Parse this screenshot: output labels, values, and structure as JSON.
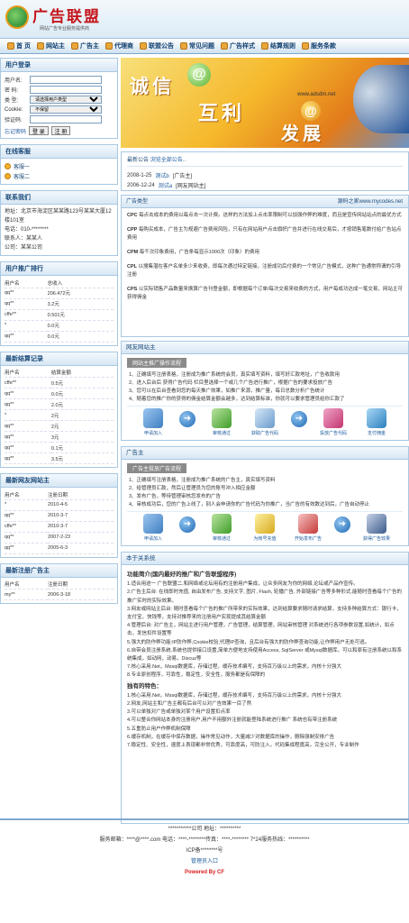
{
  "header": {
    "logo": "广告联盟",
    "slogan": "网站广告专业服务提供商"
  },
  "nav": [
    "首 页",
    "网站主",
    "广告主",
    "代理商",
    "联盟公告",
    "常见问题",
    "广告样式",
    "结算规则",
    "服务条款"
  ],
  "login": {
    "title": "用户登录",
    "user_label": "用户名:",
    "pwd_label": "密 码:",
    "type_label": "类 型:",
    "type_value": "请选择用户类型",
    "cookie_label": "Cookie:",
    "cookie_value": "不保留",
    "code_label": "验证码:",
    "forgot": "忘记密码",
    "login_btn": "登 录",
    "reg_btn": "注 册"
  },
  "service": {
    "title": "在线客服",
    "items": [
      "客服一",
      "客服二"
    ]
  },
  "contact": {
    "title": "联系我们",
    "lines": [
      "地址：北京市海淀区某某路123号某某大厦12楼101室",
      "电话：010-********",
      "联系人：某某人",
      "公司：某某公司"
    ]
  },
  "rank": {
    "title": "用户推广排行",
    "cols": [
      "用户名",
      "总收入"
    ],
    "rows": [
      [
        "qq**",
        "206.472元"
      ],
      [
        "qq**",
        "3.2元"
      ],
      [
        "cffe**",
        "0.501元"
      ],
      [
        "*",
        "0.0元"
      ],
      [
        "qq**",
        "0.0元"
      ]
    ]
  },
  "settle": {
    "title": "最新结算记录",
    "cols": [
      "用户名",
      "结算金额"
    ],
    "rows": [
      [
        "cffe**",
        "0.5元"
      ],
      [
        "qq**",
        "0.0元"
      ],
      [
        "qq**",
        "2.0元"
      ],
      [
        "*",
        "2元"
      ],
      [
        "qq**",
        "2元"
      ],
      [
        "qq**",
        "3元"
      ],
      [
        "qq**",
        "0.1元"
      ],
      [
        "qq**",
        "3.5元"
      ]
    ]
  },
  "newsite": {
    "title": "最新网友网站主",
    "cols": [
      "用户名",
      "注册日期"
    ],
    "rows": [
      [
        "*",
        "2010-4-5"
      ],
      [
        "qq**",
        "2010-3-7"
      ],
      [
        "cffe**",
        "2010-3-7"
      ],
      [
        "qq**",
        "2007-2-23"
      ],
      [
        "qq**",
        "2005-6-3"
      ]
    ]
  },
  "newadv": {
    "title": "最新注册广告主",
    "cols": [
      "用户名",
      "注册日期"
    ],
    "rows": [
      [
        "my**",
        "2006-3-18"
      ]
    ]
  },
  "banner": {
    "w1": "诚信",
    "w2": "互利",
    "w3": "发展",
    "url": "www.adsdm.net"
  },
  "announce": {
    "title": "最新公告",
    "more": "浏览全部公告..",
    "items": [
      {
        "date": "2008-1-25",
        "user": "测试b",
        "tag": "[广告主]"
      },
      {
        "date": "2006-12-24",
        "user": "测试a",
        "tag": "[网友网站主]"
      }
    ]
  },
  "adtype": {
    "title": "广告类型",
    "src": "源码之家www.mycodes.net",
    "items": [
      {
        "k": "CPC",
        "v": "每点击成本的费用以每点击一次计费。这样的方法加上点击率限制可以加强作弊的难度，而且是宣传网站站点的最优方式"
      },
      {
        "k": "CPP",
        "v": "每购买成本，广告主为规避广告费用风险，只有在网站用户点击旗帜广告并进行在线交易后，才按销售笔数付给广告站点费用"
      },
      {
        "k": "CPM",
        "v": "每千次印象费用，广告条每显示1000次（印象）的费用"
      },
      {
        "k": "CPL",
        "v": "以搜集潜在客户名单多少来收费，即每次通过特定链接，注册成功后付费的一个常见广告模式，这种广告通常称谓的引导注册"
      },
      {
        "k": "CPS",
        "v": "以实际销售产品数量来换算广告刊登金额，即根据每个订单/每次交易来收费的方式，用户每成功达成一笔交易，网站主可获得佣金"
      }
    ]
  },
  "webmaster": {
    "title": "网友网站主",
    "tab": "网站主推广操作流程",
    "steps": [
      "1、正确填写注册表格，注册成为推广系统的会员，真实填写资料，填写好汇款地址，广告收款用",
      "2、进入后台后  获得广告代码 栏目里选择一个或几个广告进行推广，根据广告的要求投放广告",
      "3、您可以在后台查看到您的每天推广效果，如推广来源，推广量，每日总数分析广告统计",
      "4、随着您的推广你的获得的佣金结算金额会越多，达到结算标准，你就可以要求管理员给你汇款了"
    ],
    "icons": [
      "申请加入",
      "审核通过",
      "获取广告代码",
      "投放广告代码",
      "支付佣金"
    ]
  },
  "advertiser": {
    "title": "广告主",
    "tab": "广告主投放广告流程",
    "steps": [
      "1、正确填写注册表格，注册成为推广系统的广告主，真实填写资料",
      "2、给管理员汇款，然后让管理员为您的账号冲入相应金额",
      "3、发布广告，等待管理审核您发布的广告",
      "4、审核成功后，您的广告上线了，别人会申请你的广告代码为你推广，当广告的有效数达到后，广告自动停止"
    ],
    "icons": [
      "申请加入",
      "审核通过",
      "为帐号充值",
      "开始发布广告",
      "获得广告效果"
    ]
  },
  "about": {
    "title": "本于关系统",
    "h1": "功能简介(国内最好的推广和广告联盟程序)",
    "lines": [
      "1.适合用途一 广告联盟二.和网络或论坛用有的注册用户集成，让众多网友为你的网络,论坛或产品作宣传。",
      "2.广告主后台: 在线即时充值, 自由发布广告, 支持文字, 图片, Flash, 轮播广告, 外部链接广告等多种形式,能随时查看每个广告的推广实时的实际效果。",
      "3.网友或网站主后台: 随时查看每个广告的推广所带来的实际效果，达到结算要求随时请求结算，支持多种结算方式：银行卡，支付宝，快钱等，支持对推荐来的注册用户实现提成其结算金额",
      "4.管理后台: 对广告主，网站主进行用户管理，广告管理，结算管理，网站审核管理  对系统进行各项参数设置,如统计，如点击，发信扣件设置等",
      "5.强大的防作弊功能:IP防作弊,Cookie校验,代理IP查询，且后台有强大的防作弊查询功能,让作弊用户无处可逃。",
      "6.自带会员注册系统.系统也提供接口设置,简单方便地支持使用Access, SqlServer  或Mysql数据库，可以和原有注册系统以和系统集成，如动网，动易，Discuz等",
      "7.核心采用.Net，Mssql数据库，存储过程，缓存技术编写，支持百万级以上的需求，内核十分强大",
      "8.专业原创程序，可靠性，稳定性，安全性，服务都是有保障的"
    ],
    "h2": "独有的特色：",
    "lines2": [
      "1.核心采用.Net，Mssql数据库，存储过程，缓存技术编写，支持百万级以上的需求，内核十分强大",
      "2.网友,网站主和广告主都有后台可以对广告效果一目了然",
      "3.可以单独对广告或单独对某个用户设置扣点率",
      "4.可以整合你网站本身的注册用户,用户不用额外注册就能登陆系统进行推广 系统也有带注册系统",
      "5.五重防止用户作弊机制保障",
      "6.缓存机制，在缓存中保存数据，操作常见动作，大量减少对数据库的操作，删除强制安排广告",
      "7.稳定性、安全性，速度上表现都非常优秀，可靠度高，可防注入，代码集成程度高，完全公开，专业制作"
    ]
  },
  "footer": {
    "l1": "***********公司  地址：**********",
    "l2": "服务邮箱：****@****.com 电话：****-********传真：****-******** 7*24服务热线：**********",
    "l3": "ICP备********号",
    "l4": "管理员入口",
    "l5": "Powered By CF"
  }
}
